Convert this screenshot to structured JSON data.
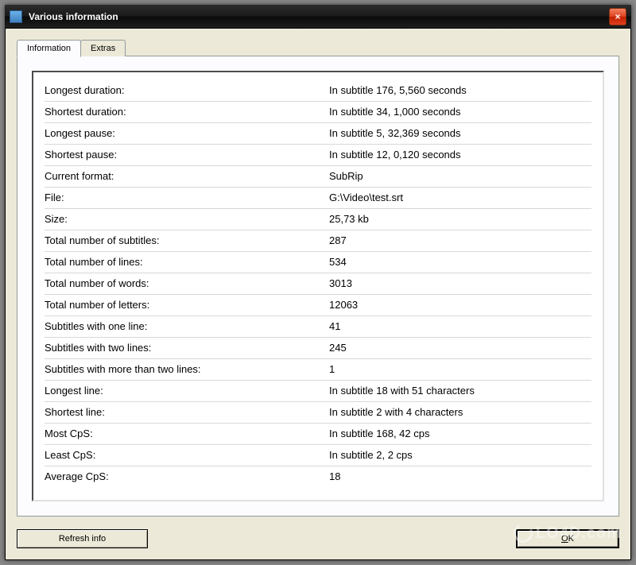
{
  "window": {
    "title": "Various information",
    "close_label": "×"
  },
  "tabs": [
    {
      "label": "Information",
      "active": true
    },
    {
      "label": "Extras",
      "active": false
    }
  ],
  "info_rows": [
    {
      "label": "Longest duration:",
      "value": "In subtitle 176, 5,560 seconds"
    },
    {
      "label": "Shortest duration:",
      "value": "In subtitle 34, 1,000 seconds"
    },
    {
      "label": "Longest pause:",
      "value": "In subtitle 5, 32,369 seconds"
    },
    {
      "label": "Shortest pause:",
      "value": "In subtitle 12, 0,120 seconds"
    },
    {
      "label": "Current format:",
      "value": "SubRip"
    },
    {
      "label": "File:",
      "value": "G:\\Video\\test.srt"
    },
    {
      "label": "Size:",
      "value": "25,73 kb"
    },
    {
      "label": "Total number of subtitles:",
      "value": "287"
    },
    {
      "label": "Total number of lines:",
      "value": "534"
    },
    {
      "label": "Total number of words:",
      "value": "3013"
    },
    {
      "label": "Total number of letters:",
      "value": "12063"
    },
    {
      "label": "Subtitles with one line:",
      "value": "41"
    },
    {
      "label": "Subtitles with two lines:",
      "value": "245"
    },
    {
      "label": "Subtitles with more than two lines:",
      "value": "1"
    },
    {
      "label": "Longest line:",
      "value": "In subtitle 18 with 51 characters"
    },
    {
      "label": "Shortest line:",
      "value": "In subtitle 2 with 4 characters"
    },
    {
      "label": "Most CpS:",
      "value": "In subtitle 168, 42 cps"
    },
    {
      "label": "Least CpS:",
      "value": "In subtitle 2, 2 cps"
    },
    {
      "label": "Average CpS:",
      "value": "18"
    }
  ],
  "buttons": {
    "refresh": "Refresh info",
    "ok_prefix": "O",
    "ok_suffix": "K"
  },
  "watermark": "LO4D.com"
}
